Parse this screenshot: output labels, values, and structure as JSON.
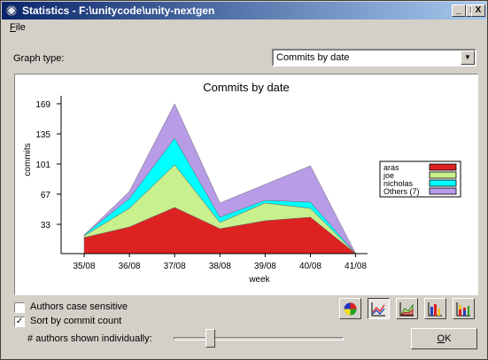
{
  "window": {
    "title": "Statistics - F:\\unitycode\\unity-nextgen",
    "minimize": "_",
    "maximize": "□",
    "close": "X"
  },
  "menu": {
    "file_mnemonic": "F",
    "file_rest": "ile"
  },
  "graph_type": {
    "label": "Graph type:",
    "selected": "Commits by date"
  },
  "chart_data": {
    "type": "area",
    "stacked": true,
    "title": "Commits by date",
    "xlabel": "week",
    "ylabel": "commits",
    "categories": [
      "35/08",
      "36/08",
      "37/08",
      "38/08",
      "39/08",
      "40/08",
      "41/08"
    ],
    "yticks": [
      33,
      67,
      101,
      135,
      169
    ],
    "ylim": [
      0,
      172
    ],
    "legend_position": "right",
    "series": [
      {
        "name": "aras",
        "color": "#dd2222",
        "values": [
          18,
          30,
          52,
          28,
          37,
          41,
          0
        ]
      },
      {
        "name": "joe",
        "color": "#c8f08c",
        "values": [
          2,
          21,
          48,
          7,
          20,
          10,
          0
        ]
      },
      {
        "name": "nicholas",
        "color": "#00ffff",
        "values": [
          1,
          11,
          30,
          6,
          3,
          7,
          0
        ]
      },
      {
        "name": "Others (7)",
        "color": "#b89ce8",
        "values": [
          0,
          8,
          39,
          16,
          18,
          41,
          0
        ]
      }
    ]
  },
  "options": {
    "case_sensitive": {
      "label": "Authors case sensitive",
      "checked": false,
      "mark": ""
    },
    "sort_by_count": {
      "label": "Sort by commit count",
      "checked": true,
      "mark": "✓"
    }
  },
  "authors_shown": {
    "label": "# authors shown individually:",
    "level": 0.2
  },
  "ok": {
    "mnemonic": "O",
    "rest": "K"
  },
  "colors": {
    "titlebar_start": "#0a246a",
    "titlebar_end": "#a6caf0",
    "face": "#d4d0c8"
  }
}
